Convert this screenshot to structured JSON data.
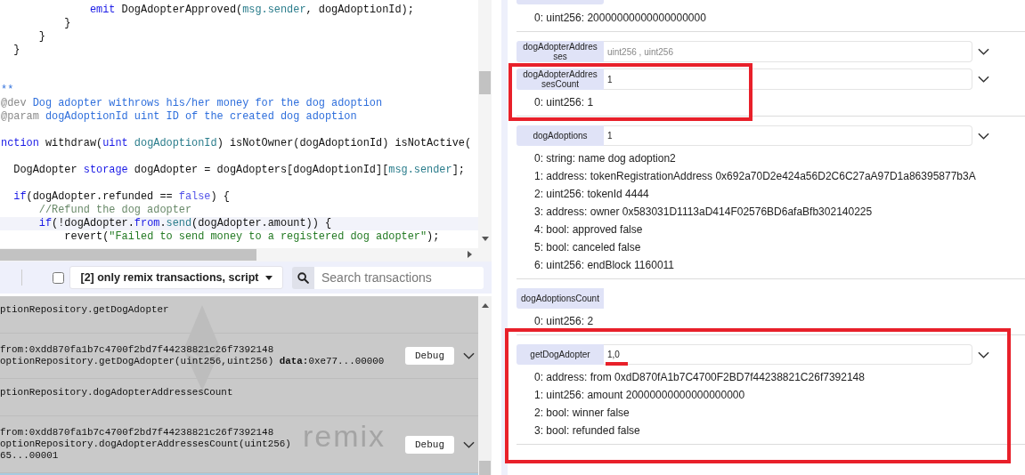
{
  "editor": {
    "lines": [
      {
        "highlighted": false,
        "tokens": [
          {
            "kind": "kw",
            "text": "              emit"
          },
          {
            "kind": "plain",
            "text": " DogAdopterApproved("
          },
          {
            "kind": "var",
            "text": "msg.sender"
          },
          {
            "kind": "plain",
            "text": ", dogAdoptionId);"
          }
        ]
      },
      {
        "highlighted": false,
        "tokens": [
          {
            "kind": "plain",
            "text": "          }"
          }
        ]
      },
      {
        "highlighted": false,
        "tokens": [
          {
            "kind": "plain",
            "text": "      }"
          }
        ]
      },
      {
        "highlighted": false,
        "tokens": [
          {
            "kind": "plain",
            "text": "  }"
          }
        ]
      },
      {
        "highlighted": false
      },
      {
        "highlighted": false
      },
      {
        "highlighted": false,
        "tokens": [
          {
            "kind": "doc",
            "text": "**"
          }
        ]
      },
      {
        "highlighted": false,
        "tokens": [
          {
            "kind": "doctag",
            "text": "@dev"
          },
          {
            "kind": "doc",
            "text": " Dog adopter withrows his/her money for the dog adoption"
          }
        ]
      },
      {
        "highlighted": false,
        "tokens": [
          {
            "kind": "doctag",
            "text": "@param"
          },
          {
            "kind": "doc",
            "text": " dogAdoptionId uint ID of the created dog adoption"
          }
        ]
      },
      {
        "highlighted": false
      },
      {
        "highlighted": false,
        "tokens": [
          {
            "kind": "kw",
            "text": "nction"
          },
          {
            "kind": "plain",
            "text": " withdraw("
          },
          {
            "kind": "kw",
            "text": "uint"
          },
          {
            "kind": "var",
            "text": " dogAdoptionId"
          },
          {
            "kind": "plain",
            "text": ") isNotOwner(dogAdoptionId) isNotActive("
          }
        ]
      },
      {
        "highlighted": false
      },
      {
        "highlighted": false,
        "tokens": [
          {
            "kind": "plain",
            "text": "  DogAdopter "
          },
          {
            "kind": "kw",
            "text": "storage"
          },
          {
            "kind": "plain",
            "text": " dogAdopter = dogAdopters[dogAdoptionId]["
          },
          {
            "kind": "var",
            "text": "msg.sender"
          },
          {
            "kind": "plain",
            "text": "];"
          }
        ]
      },
      {
        "highlighted": false
      },
      {
        "highlighted": false,
        "tokens": [
          {
            "kind": "kw",
            "text": "  if"
          },
          {
            "kind": "plain",
            "text": "(dogAdopter.refunded == "
          },
          {
            "kind": "lit",
            "text": "false"
          },
          {
            "kind": "plain",
            "text": ") {"
          }
        ]
      },
      {
        "highlighted": false,
        "tokens": [
          {
            "kind": "comment",
            "text": "      //Refund the dog adopter"
          }
        ]
      },
      {
        "highlighted": true,
        "tokens": [
          {
            "kind": "kw",
            "text": "      if"
          },
          {
            "kind": "plain",
            "text": "(!dogAdopter."
          },
          {
            "kind": "kw",
            "text": "from"
          },
          {
            "kind": "plain",
            "text": "."
          },
          {
            "kind": "var",
            "text": "send"
          },
          {
            "kind": "plain",
            "text": "(dogAdopter.amount)) {"
          }
        ]
      },
      {
        "highlighted": false,
        "tokens": [
          {
            "kind": "plain",
            "text": "          revert("
          },
          {
            "kind": "str",
            "text": "\"Failed to send money to a registered dog adopter\""
          },
          {
            "kind": "plain",
            "text": ");"
          }
        ]
      }
    ]
  },
  "terminal": {
    "checkbox": {
      "checked": false
    },
    "filter": {
      "label": "[2] only remix transactions, script"
    },
    "search": {
      "placeholder": "Search transactions"
    },
    "logo_text": "remix",
    "entries": [
      {
        "kind": "call",
        "lines": [
          "ptionRepository.getDogAdopter"
        ]
      },
      {
        "kind": "detail",
        "lines": [
          "from:0xdd870fa1b7c4700f2bd7f44238821c26f7392148",
          "optionRepository.getDogAdopter(uint256,uint256) **data:**0xe77...00000"
        ],
        "button": "Debug"
      },
      {
        "kind": "call",
        "lines": [
          "ptionRepository.dogAdopterAddressesCount"
        ]
      },
      {
        "kind": "detail",
        "lines": [
          "from:0xdd870fa1b7c4700f2bd7f44238821c26f7392148",
          "optionRepository.dogAdopterAddressesCount(uint256)",
          "65...00001"
        ],
        "button": "Debug"
      }
    ]
  },
  "functions": [
    {
      "kind": "cut",
      "outputs": [
        "0: uint256: 20000000000000000000"
      ]
    },
    {
      "kind": "input",
      "label": "dogAdopterAddresses",
      "placeholder": "uint256 , uint256"
    },
    {
      "kind": "input",
      "label": "dogAdopterAddressesCount",
      "value": "1",
      "highlight": {
        "kind": "narrow"
      },
      "value_marked": false,
      "outputs": [
        "0: uint256: 1"
      ]
    },
    {
      "kind": "input",
      "label": "dogAdoptions",
      "value": "1",
      "value_marked": false,
      "outputs": [
        "0: string: name dog adoption2",
        "1: address: tokenRegistrationAddress 0x692a70D2e424a56D2C6C27aA97D1a86395877b3A",
        "2: uint256: tokenId 4444",
        "3: address: owner 0x583031D1113aD414F02576BD6afaBfb302140225",
        "4: bool: approved false",
        "5: bool: canceled false",
        "6: uint256: endBlock 1160011"
      ]
    },
    {
      "kind": "noinput",
      "label": "dogAdoptionsCount",
      "outputs": [
        "0: uint256: 2"
      ]
    },
    {
      "kind": "input",
      "label": "getDogAdopter",
      "value": "1,0",
      "highlight": {
        "kind": "wide"
      },
      "value_marked": true,
      "outputs": [
        "0: address: from 0xdD870fA1b7C4700F2BD7f44238821C26f7392148",
        "1: uint256: amount 20000000000000000000",
        "2: bool: winner false",
        "3: bool: refunded false"
      ]
    }
  ]
}
